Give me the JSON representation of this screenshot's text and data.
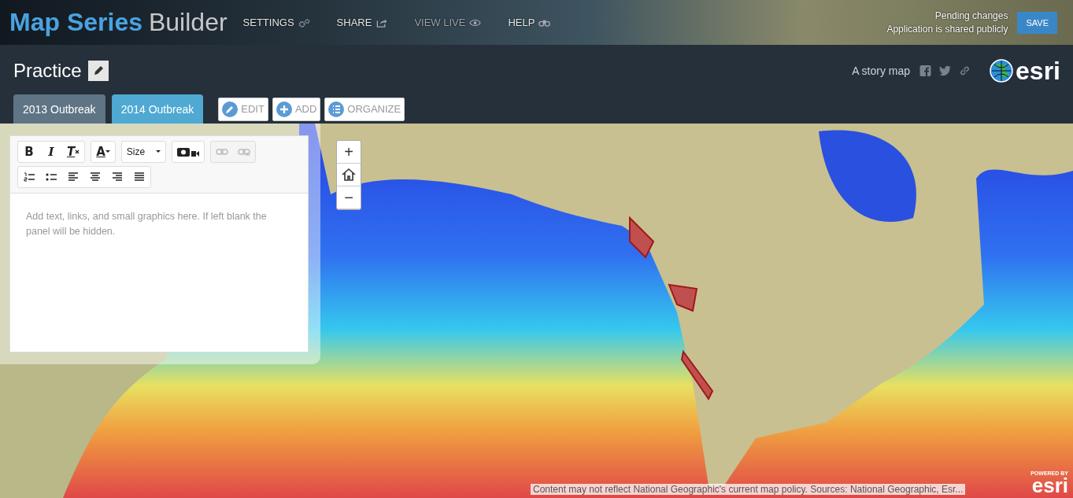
{
  "header": {
    "title_bold": "Map Series",
    "title_light": "Builder",
    "nav": [
      {
        "label": "SETTINGS",
        "kind": "gears",
        "disabled": false
      },
      {
        "label": "SHARE",
        "kind": "share",
        "disabled": false
      },
      {
        "label": "VIEW LIVE",
        "kind": "eye",
        "disabled": true
      },
      {
        "label": "HELP",
        "kind": "binoculars",
        "disabled": false
      }
    ],
    "status": [
      "Pending changes",
      "Application is shared publicly"
    ],
    "save": "SAVE"
  },
  "story": {
    "title": "Practice",
    "subtitle": "A story map",
    "logo": "esri"
  },
  "tabs": [
    {
      "label": "2013 Outbreak",
      "selected": false
    },
    {
      "label": "2014 Outbreak",
      "selected": true
    }
  ],
  "actions": [
    {
      "label": "EDIT",
      "kind": "pencil"
    },
    {
      "label": "ADD",
      "kind": "plus"
    },
    {
      "label": "ORGANIZE",
      "kind": "list"
    }
  ],
  "editor": {
    "toolbar": [
      [
        {
          "disabled": false,
          "items": [
            {
              "kind": "bold",
              "label": "B"
            },
            {
              "kind": "italic",
              "label": "I"
            },
            {
              "kind": "clear",
              "label": "T"
            }
          ]
        },
        {
          "disabled": false,
          "items": [
            {
              "kind": "color",
              "label": "A"
            }
          ]
        },
        {
          "disabled": false,
          "items": [
            {
              "kind": "size",
              "label": "Size"
            }
          ]
        },
        {
          "disabled": false,
          "items": [
            {
              "kind": "media"
            }
          ]
        },
        {
          "disabled": true,
          "items": [
            {
              "kind": "link"
            },
            {
              "kind": "unlink"
            }
          ]
        }
      ],
      [
        {
          "disabled": false,
          "items": [
            {
              "kind": "ol"
            },
            {
              "kind": "ul"
            },
            {
              "kind": "left"
            },
            {
              "kind": "center"
            },
            {
              "kind": "right"
            },
            {
              "kind": "justify"
            }
          ]
        }
      ]
    ],
    "placeholder": "Add text, links, and small graphics here. If left blank the panel will be hidden."
  },
  "zoom": {
    "in": "+",
    "out": "−"
  },
  "attribution": "Content may not reflect National Geographic's current map policy. Sources: National Geographic, Esr...",
  "powered": {
    "label": "POWERED BY",
    "logo": "esri"
  }
}
